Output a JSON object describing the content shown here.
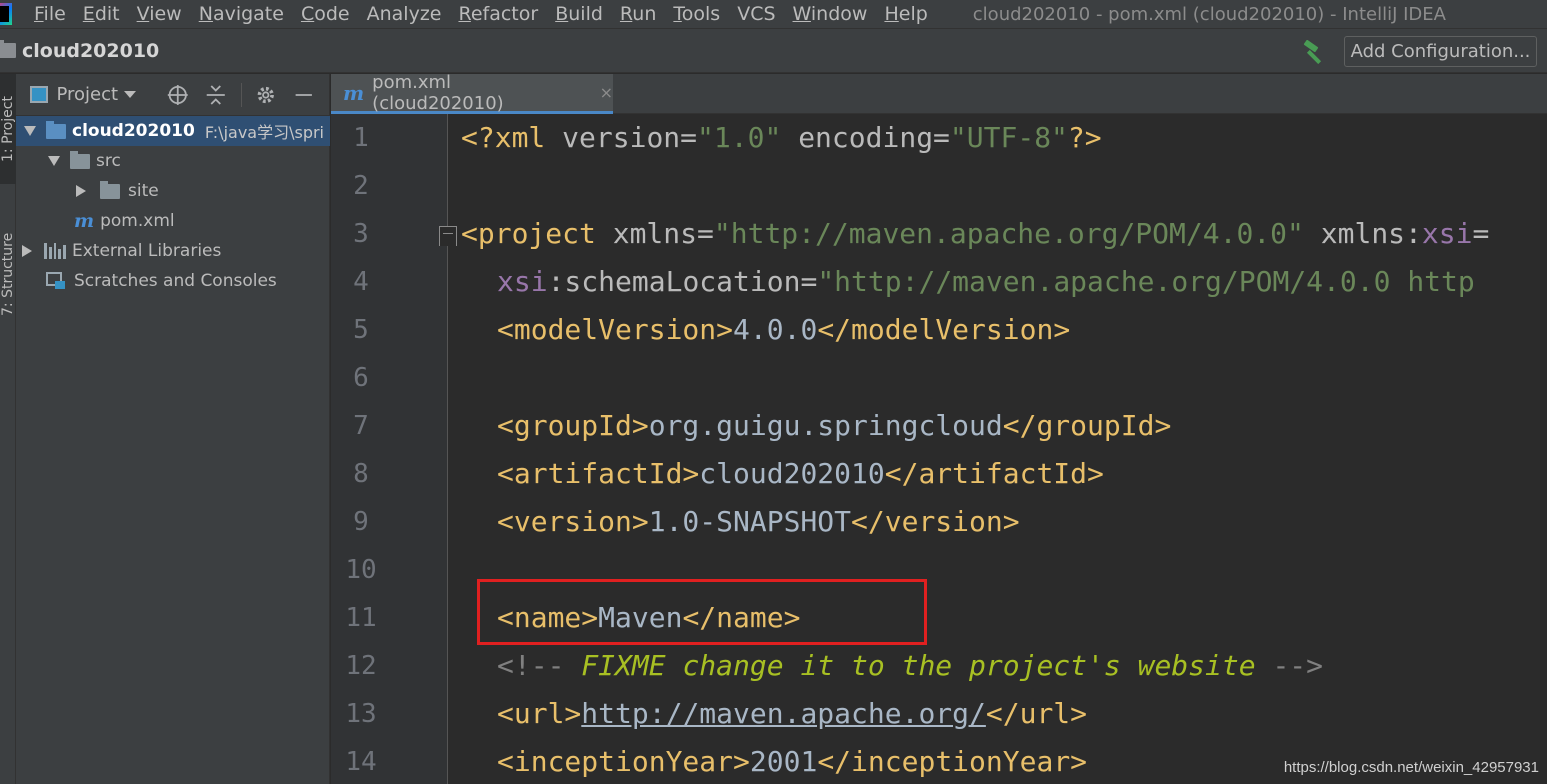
{
  "menu": {
    "items": [
      {
        "mnemonic": "F",
        "rest": "ile"
      },
      {
        "mnemonic": "E",
        "rest": "dit"
      },
      {
        "mnemonic": "V",
        "rest": "iew"
      },
      {
        "mnemonic": "N",
        "rest": "avigate"
      },
      {
        "mnemonic": "C",
        "rest": "ode"
      },
      {
        "mnemonic": "",
        "rest": "Analyze"
      },
      {
        "mnemonic": "R",
        "rest": "efactor"
      },
      {
        "mnemonic": "B",
        "rest": "uild"
      },
      {
        "mnemonic": "R",
        "rest": "un"
      },
      {
        "mnemonic": "T",
        "rest": "ools"
      },
      {
        "mnemonic": "",
        "rest": "VCS"
      },
      {
        "mnemonic": "W",
        "rest": "indow"
      },
      {
        "mnemonic": "H",
        "rest": "elp"
      }
    ],
    "window_title": "cloud202010 - pom.xml (cloud202010) - IntelliJ IDEA"
  },
  "navbar": {
    "project_name": "cloud202010",
    "add_configuration": "Add Configuration..."
  },
  "tool_stripe": {
    "project_tab": "1: Project",
    "structure_tab": "7: Structure"
  },
  "project_panel": {
    "title": "Project",
    "tree": {
      "root_name": "cloud202010",
      "root_path": "F:\\java学习\\spri",
      "src": "src",
      "site": "site",
      "pom": "pom.xml",
      "external_libraries": "External Libraries",
      "scratches": "Scratches and Consoles"
    }
  },
  "editor": {
    "tab_label": "pom.xml (cloud202010)",
    "tab_close": "×",
    "line_numbers": [
      "1",
      "2",
      "3",
      "4",
      "5",
      "6",
      "7",
      "8",
      "9",
      "10",
      "11",
      "12",
      "13",
      "14"
    ],
    "code": {
      "l1": {
        "open": "<?xml ",
        "a1": "version",
        "eq1": "=",
        "v1": "\"1.0\"",
        "sp": " ",
        "a2": "encoding",
        "eq2": "=",
        "v2": "\"UTF-8\"",
        "close": "?>"
      },
      "l3": {
        "open": "<project ",
        "a1": "xmlns",
        "eq1": "=",
        "v1": "\"http://maven.apache.org/POM/4.0.0\"",
        "sp": " ",
        "a2": "xmlns:",
        "ns2": "xsi",
        "eq2": "="
      },
      "l4": {
        "ns": "xsi",
        "a": ":schemaLocation",
        "eq": "=",
        "v": "\"http://maven.apache.org/POM/4.0.0 http"
      },
      "l5": {
        "open": "<modelVersion>",
        "text": "4.0.0",
        "close": "</modelVersion>"
      },
      "l7": {
        "open": "<groupId>",
        "text": "org.guigu.springcloud",
        "close": "</groupId>"
      },
      "l8": {
        "open": "<artifactId>",
        "text": "cloud202010",
        "close": "</artifactId>"
      },
      "l9": {
        "open": "<version>",
        "text": "1.0-SNAPSHOT",
        "close": "</version>"
      },
      "l11": {
        "open": "<name>",
        "text": "Maven",
        "close": "</name>"
      },
      "l12": {
        "open": "<!-- ",
        "todo": "FIXME change it to the project's website",
        "close": " -->"
      },
      "l13": {
        "open": "<url>",
        "link": "http://maven.apache.org/",
        "close": "</url>"
      },
      "l14": {
        "open": "<inceptionYear>",
        "text": "2001",
        "close": "</inceptionYear>"
      }
    }
  },
  "watermark": "https://blog.csdn.net/weixin_42957931",
  "colors": {
    "tag": "#e8bf6a",
    "attr_value": "#6a8759",
    "namespace": "#9876aa",
    "comment": "#808080",
    "todo": "#a8c023",
    "highlight_box": "#e02020"
  }
}
